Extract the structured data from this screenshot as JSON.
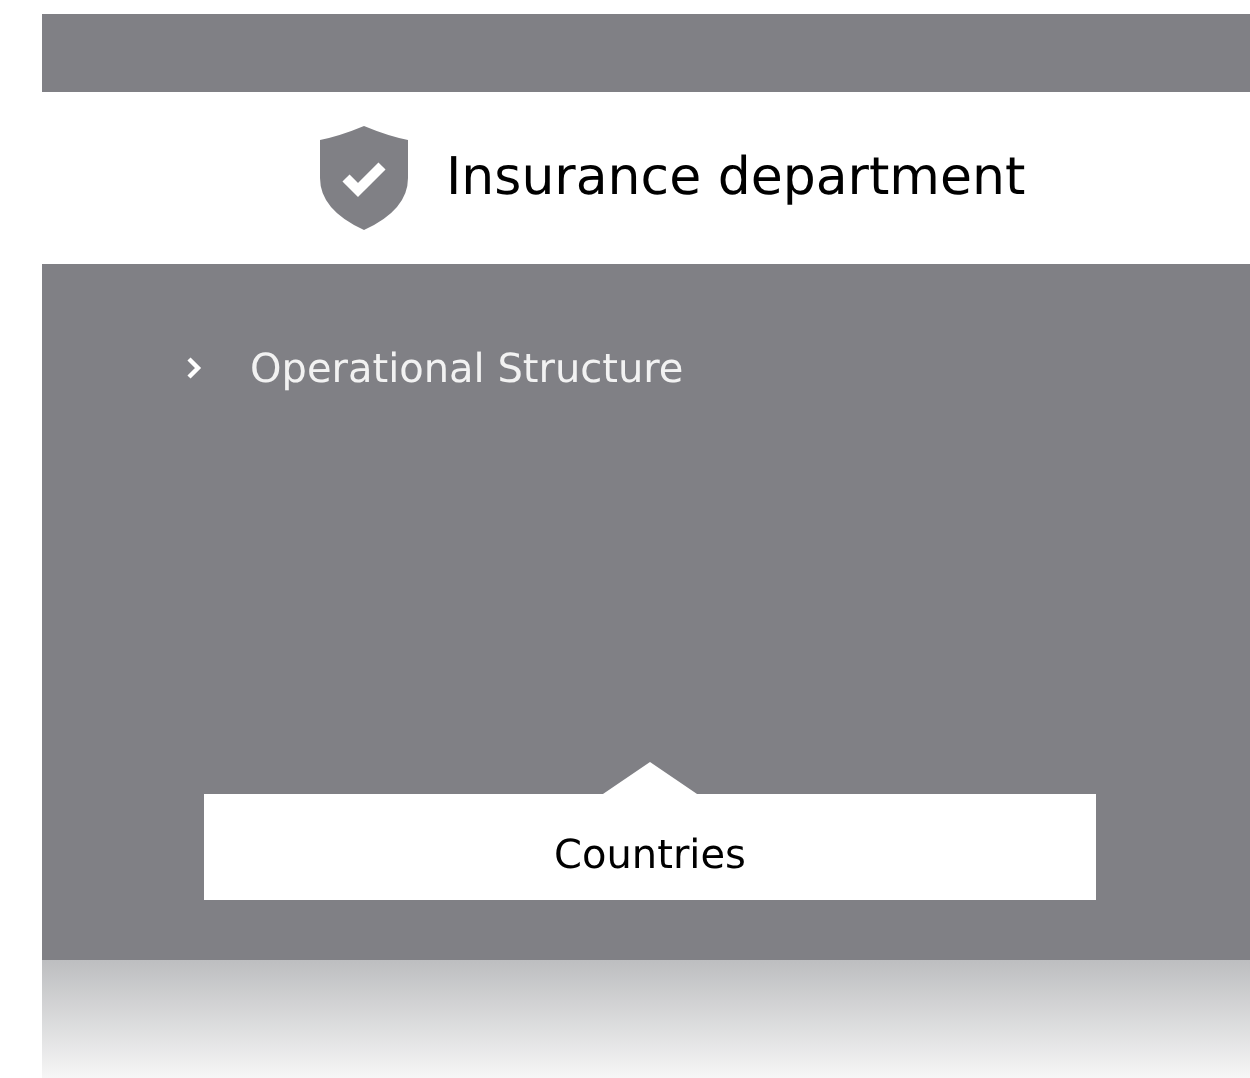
{
  "header": {
    "title": "Insurance department"
  },
  "menu": [
    {
      "label": "Operational Structure",
      "expanded": false
    }
  ],
  "tab": {
    "label": "Countries"
  }
}
